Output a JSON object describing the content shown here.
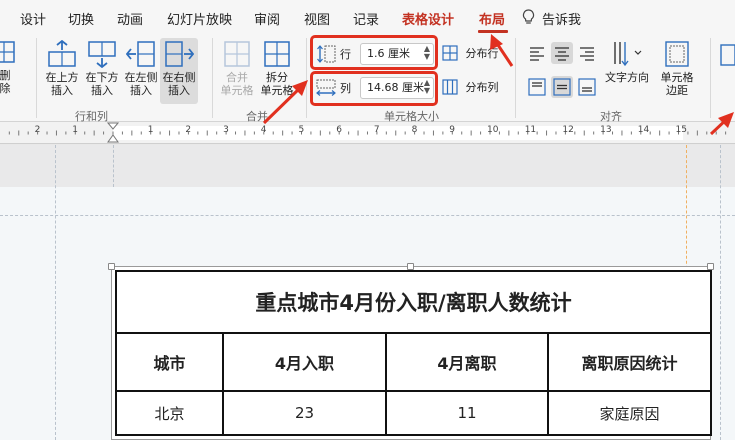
{
  "tabs": [
    {
      "label": "设计",
      "active": false
    },
    {
      "label": "切换",
      "active": false
    },
    {
      "label": "动画",
      "active": false
    },
    {
      "label": "幻灯片放映",
      "active": false
    },
    {
      "label": "审阅",
      "active": false
    },
    {
      "label": "视图",
      "active": false
    },
    {
      "label": "记录",
      "active": false
    },
    {
      "label": "表格设计",
      "active": false
    },
    {
      "label": "布局",
      "active": true
    },
    {
      "label": "告诉我",
      "active": false
    }
  ],
  "ribbon": {
    "rows_cols": {
      "delete_label": "删除",
      "insert_above_1": "在上方",
      "insert_above_2": "插入",
      "insert_below_1": "在下方",
      "insert_below_2": "插入",
      "insert_left_1": "在左侧",
      "insert_left_2": "插入",
      "insert_right_1": "在右侧",
      "insert_right_2": "插入",
      "group_label": "行和列"
    },
    "merge": {
      "merge_1": "合并",
      "merge_2": "单元格",
      "split_1": "拆分",
      "split_2": "单元格",
      "group_label": "合并"
    },
    "cell_size": {
      "row_label": "行",
      "row_value": "1.6 厘米",
      "col_label": "列",
      "col_value": "14.68 厘米",
      "distribute_rows": "分布行",
      "distribute_cols": "分布列",
      "group_label": "单元格大小"
    },
    "alignment": {
      "text_direction": "文字方向",
      "cell_margin_1": "单元格",
      "cell_margin_2": "边距",
      "group_label": "对齐"
    }
  },
  "ruler": {
    "numbers": [
      "2",
      "1",
      "1",
      "2",
      "3",
      "4",
      "5",
      "6",
      "7",
      "8",
      "9",
      "10",
      "11",
      "12",
      "13",
      "14",
      "15"
    ]
  },
  "table": {
    "title": "重点城市4月份入职/离职人数统计",
    "headers": [
      "城市",
      "4月入职",
      "4月离职",
      "离职原因统计"
    ],
    "rows": [
      [
        "北京",
        "23",
        "11",
        "家庭原因"
      ]
    ]
  },
  "colors": {
    "accent_red": "#c33222",
    "highlight_red": "#e1301f",
    "ribbon_bg": "#f6f6f6",
    "icon_blue": "#2f6fbd"
  },
  "icons": {
    "tell_me": "lightbulb-icon",
    "row_height": "row-height-icon",
    "col_width": "column-width-icon"
  }
}
